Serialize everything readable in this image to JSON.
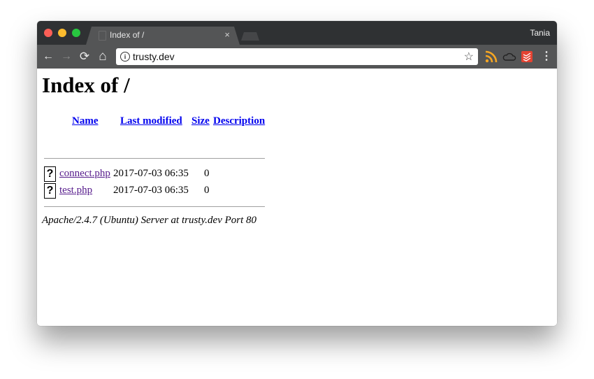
{
  "browser": {
    "tab_title": "Index of /",
    "tab_close": "×",
    "user_name": "Tania",
    "url": "trusty.dev",
    "nav": {
      "back": "←",
      "forward": "→",
      "reload": "⟳",
      "home": "⌂"
    },
    "bookmark_star": "☆",
    "menu": "⋮",
    "colors": {
      "traffic_close": "#fc5f57",
      "traffic_min": "#fdbc2e",
      "traffic_max": "#28c840",
      "rss": "#f5a623",
      "todoist": "#e44332"
    }
  },
  "page": {
    "heading": "Index of /",
    "columns": [
      "Name",
      "Last modified",
      "Size",
      "Description"
    ],
    "files": [
      {
        "icon": "?",
        "name": "connect.php",
        "modified": "2017-07-03 06:35",
        "size": "0",
        "description": ""
      },
      {
        "icon": "?",
        "name": "test.php",
        "modified": "2017-07-03 06:35",
        "size": "0",
        "description": ""
      }
    ],
    "server_signature": "Apache/2.4.7 (Ubuntu) Server at trusty.dev Port 80"
  }
}
